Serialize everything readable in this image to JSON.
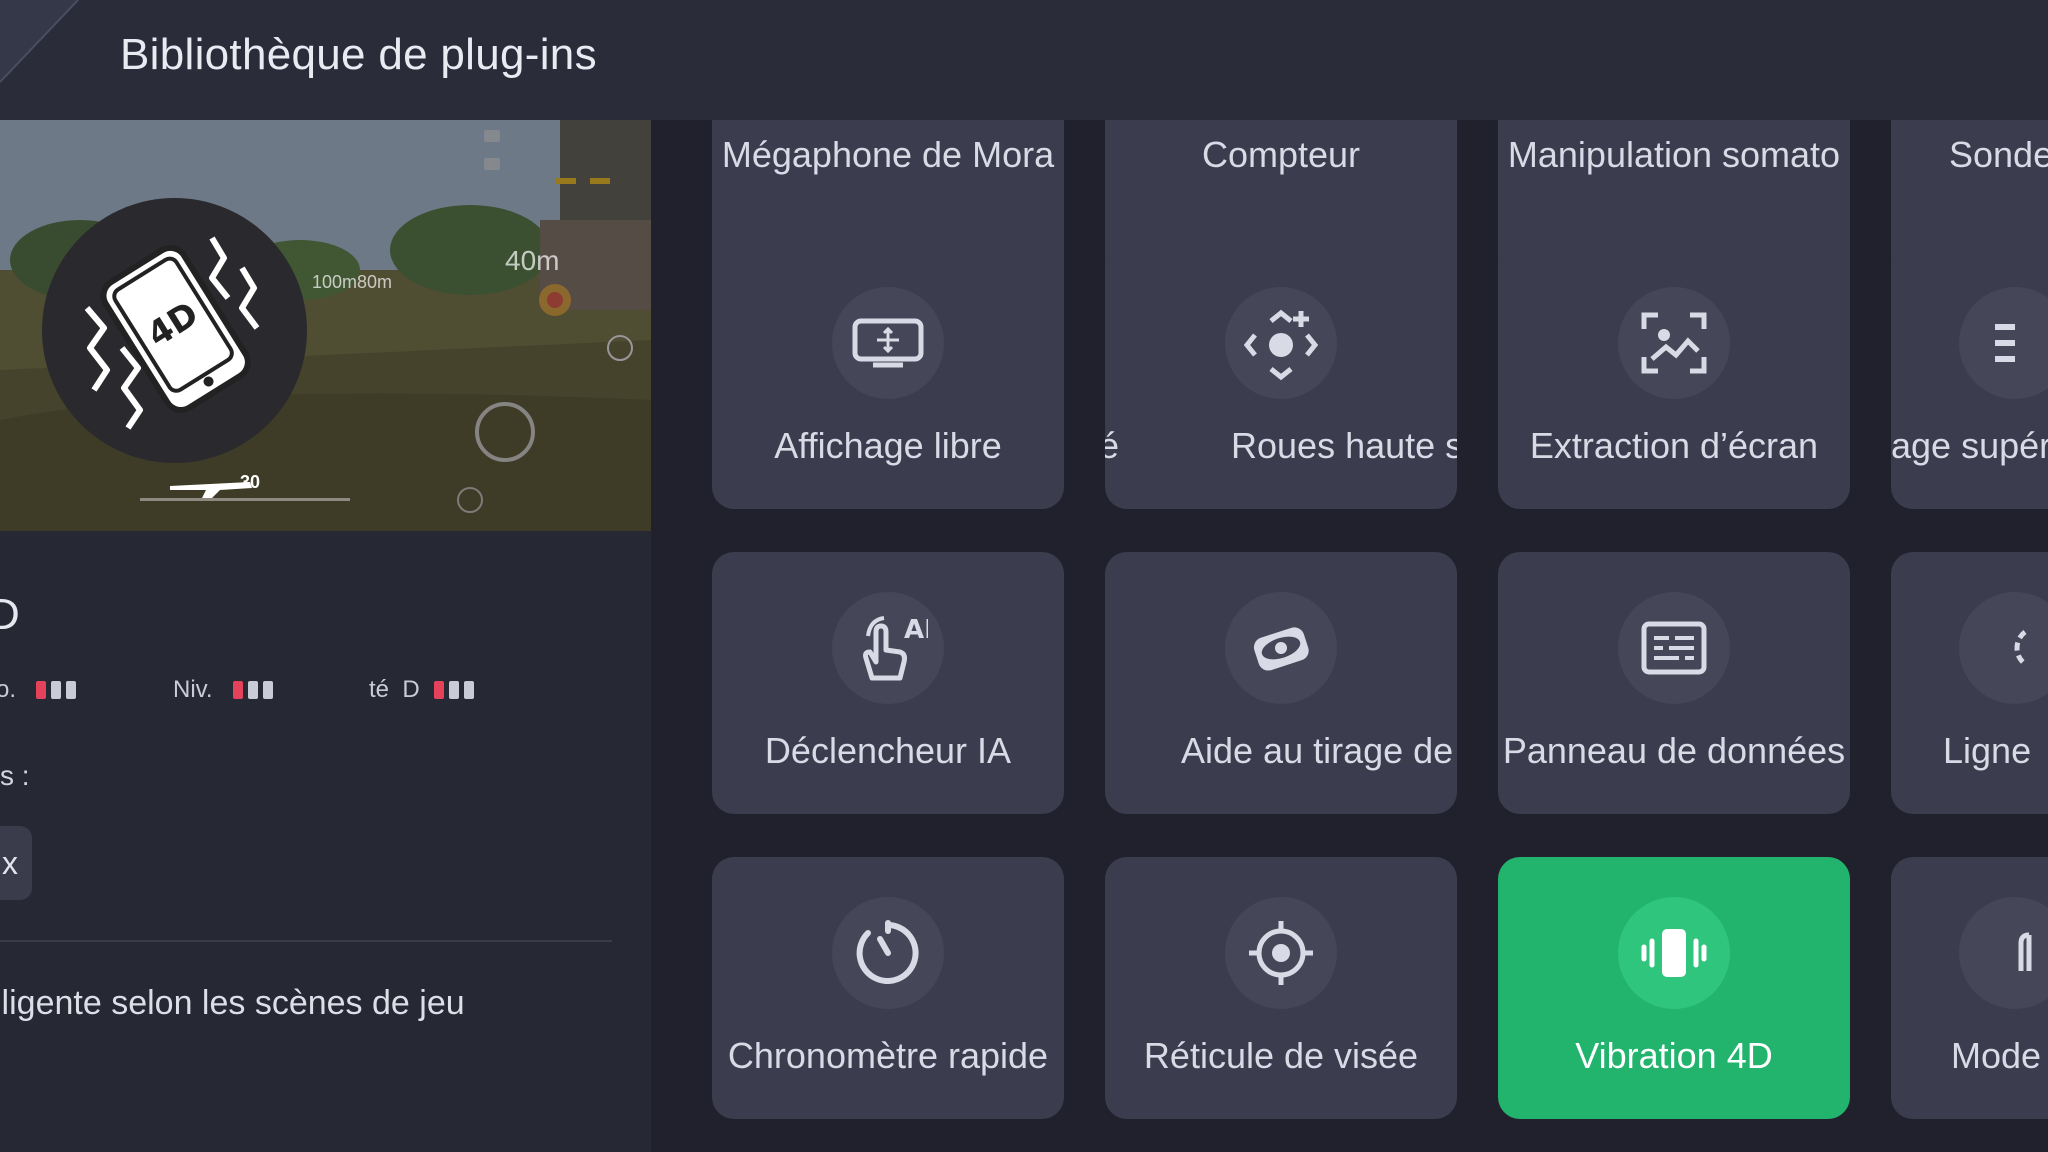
{
  "header": {
    "title": "Bibliothèque de plug-ins"
  },
  "left": {
    "name_fragment": "D",
    "preview_hud": {
      "distance1": "100m80m",
      "distance2": "40m",
      "ammo": "30"
    },
    "stats": [
      {
        "label": "o.",
        "filled": 1,
        "total": 3
      },
      {
        "label": "Niv.",
        "filled": 1,
        "total": 3
      },
      {
        "label": "té  D",
        "filled": 1,
        "total": 3
      }
    ],
    "tags_label": "s :",
    "tag_chip": "x",
    "description": "lligente selon les scènes de jeu"
  },
  "tiles": {
    "row0": [
      "Mégaphone de Mora",
      "Compteur",
      "Manipulation somato",
      "Sonde"
    ],
    "row1": [
      "Affichage libre",
      "Roues haute s",
      "Extraction d’écran",
      "age supér"
    ],
    "row1_clip": "é",
    "row2": [
      "Déclencheur IA",
      "Aide au tirage de",
      "Panneau de données",
      "Ligne"
    ],
    "row3": [
      "Chronomètre rapide",
      "Réticule de visée",
      "Vibration 4D",
      "Mode"
    ],
    "ai_badge": "AI",
    "active_tile": "Vibration 4D"
  },
  "colors": {
    "background": "#20212c",
    "tile": "#3b3d4e",
    "active": "#22b46c",
    "accent_red": "#e3425a"
  }
}
